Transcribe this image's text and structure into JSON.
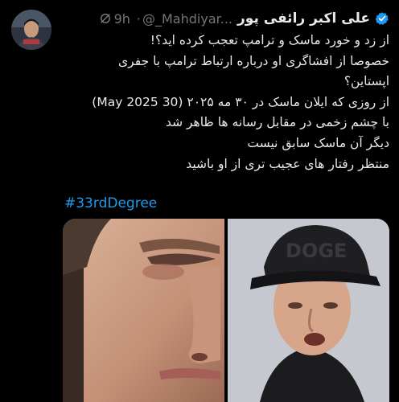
{
  "author": {
    "display_name": "علی اکبر رائفی پور",
    "handle": "@_Mahdiyar...",
    "separator": "·",
    "time": "9h"
  },
  "tweet": {
    "lines": [
      "از زد و خورد ماسک و ترامپ تعجب کرده اید؟!",
      "خصوصا از افشاگری او درباره ارتباط ترامپ با جفری",
      "اپستاین؟",
      "از روزی که ایلان ماسک در ۳۰ مه ۲۰۲۵ (May 2025 30)",
      "با چشم زخمی در مقابل رسانه ها ظاهر شد",
      "دیگر آن ماسک سابق نیست",
      "منتظر رفتار های عجیب تری از او باشید"
    ],
    "hashtag": "#33rdDegree"
  },
  "media": {
    "images": [
      "closeup-face-photo",
      "cap-portrait-photo"
    ],
    "cap_text": "DOGE"
  },
  "icons": {
    "verified": "verified-badge-icon",
    "mute": "mute-icon"
  },
  "colors": {
    "background": "#000000",
    "text": "#e7e9ea",
    "secondary": "#71767b",
    "link": "#1d9bf0",
    "verified": "#1d9bf0"
  }
}
